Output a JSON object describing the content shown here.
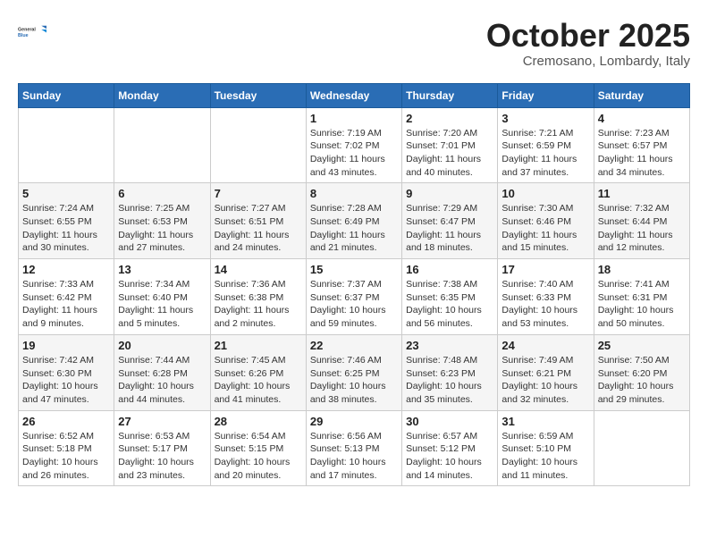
{
  "logo": {
    "general": "General",
    "blue": "Blue"
  },
  "header": {
    "month": "October 2025",
    "location": "Cremosano, Lombardy, Italy"
  },
  "weekdays": [
    "Sunday",
    "Monday",
    "Tuesday",
    "Wednesday",
    "Thursday",
    "Friday",
    "Saturday"
  ],
  "weeks": [
    [
      {
        "day": "",
        "info": ""
      },
      {
        "day": "",
        "info": ""
      },
      {
        "day": "",
        "info": ""
      },
      {
        "day": "1",
        "info": "Sunrise: 7:19 AM\nSunset: 7:02 PM\nDaylight: 11 hours\nand 43 minutes."
      },
      {
        "day": "2",
        "info": "Sunrise: 7:20 AM\nSunset: 7:01 PM\nDaylight: 11 hours\nand 40 minutes."
      },
      {
        "day": "3",
        "info": "Sunrise: 7:21 AM\nSunset: 6:59 PM\nDaylight: 11 hours\nand 37 minutes."
      },
      {
        "day": "4",
        "info": "Sunrise: 7:23 AM\nSunset: 6:57 PM\nDaylight: 11 hours\nand 34 minutes."
      }
    ],
    [
      {
        "day": "5",
        "info": "Sunrise: 7:24 AM\nSunset: 6:55 PM\nDaylight: 11 hours\nand 30 minutes."
      },
      {
        "day": "6",
        "info": "Sunrise: 7:25 AM\nSunset: 6:53 PM\nDaylight: 11 hours\nand 27 minutes."
      },
      {
        "day": "7",
        "info": "Sunrise: 7:27 AM\nSunset: 6:51 PM\nDaylight: 11 hours\nand 24 minutes."
      },
      {
        "day": "8",
        "info": "Sunrise: 7:28 AM\nSunset: 6:49 PM\nDaylight: 11 hours\nand 21 minutes."
      },
      {
        "day": "9",
        "info": "Sunrise: 7:29 AM\nSunset: 6:47 PM\nDaylight: 11 hours\nand 18 minutes."
      },
      {
        "day": "10",
        "info": "Sunrise: 7:30 AM\nSunset: 6:46 PM\nDaylight: 11 hours\nand 15 minutes."
      },
      {
        "day": "11",
        "info": "Sunrise: 7:32 AM\nSunset: 6:44 PM\nDaylight: 11 hours\nand 12 minutes."
      }
    ],
    [
      {
        "day": "12",
        "info": "Sunrise: 7:33 AM\nSunset: 6:42 PM\nDaylight: 11 hours\nand 9 minutes."
      },
      {
        "day": "13",
        "info": "Sunrise: 7:34 AM\nSunset: 6:40 PM\nDaylight: 11 hours\nand 5 minutes."
      },
      {
        "day": "14",
        "info": "Sunrise: 7:36 AM\nSunset: 6:38 PM\nDaylight: 11 hours\nand 2 minutes."
      },
      {
        "day": "15",
        "info": "Sunrise: 7:37 AM\nSunset: 6:37 PM\nDaylight: 10 hours\nand 59 minutes."
      },
      {
        "day": "16",
        "info": "Sunrise: 7:38 AM\nSunset: 6:35 PM\nDaylight: 10 hours\nand 56 minutes."
      },
      {
        "day": "17",
        "info": "Sunrise: 7:40 AM\nSunset: 6:33 PM\nDaylight: 10 hours\nand 53 minutes."
      },
      {
        "day": "18",
        "info": "Sunrise: 7:41 AM\nSunset: 6:31 PM\nDaylight: 10 hours\nand 50 minutes."
      }
    ],
    [
      {
        "day": "19",
        "info": "Sunrise: 7:42 AM\nSunset: 6:30 PM\nDaylight: 10 hours\nand 47 minutes."
      },
      {
        "day": "20",
        "info": "Sunrise: 7:44 AM\nSunset: 6:28 PM\nDaylight: 10 hours\nand 44 minutes."
      },
      {
        "day": "21",
        "info": "Sunrise: 7:45 AM\nSunset: 6:26 PM\nDaylight: 10 hours\nand 41 minutes."
      },
      {
        "day": "22",
        "info": "Sunrise: 7:46 AM\nSunset: 6:25 PM\nDaylight: 10 hours\nand 38 minutes."
      },
      {
        "day": "23",
        "info": "Sunrise: 7:48 AM\nSunset: 6:23 PM\nDaylight: 10 hours\nand 35 minutes."
      },
      {
        "day": "24",
        "info": "Sunrise: 7:49 AM\nSunset: 6:21 PM\nDaylight: 10 hours\nand 32 minutes."
      },
      {
        "day": "25",
        "info": "Sunrise: 7:50 AM\nSunset: 6:20 PM\nDaylight: 10 hours\nand 29 minutes."
      }
    ],
    [
      {
        "day": "26",
        "info": "Sunrise: 6:52 AM\nSunset: 5:18 PM\nDaylight: 10 hours\nand 26 minutes."
      },
      {
        "day": "27",
        "info": "Sunrise: 6:53 AM\nSunset: 5:17 PM\nDaylight: 10 hours\nand 23 minutes."
      },
      {
        "day": "28",
        "info": "Sunrise: 6:54 AM\nSunset: 5:15 PM\nDaylight: 10 hours\nand 20 minutes."
      },
      {
        "day": "29",
        "info": "Sunrise: 6:56 AM\nSunset: 5:13 PM\nDaylight: 10 hours\nand 17 minutes."
      },
      {
        "day": "30",
        "info": "Sunrise: 6:57 AM\nSunset: 5:12 PM\nDaylight: 10 hours\nand 14 minutes."
      },
      {
        "day": "31",
        "info": "Sunrise: 6:59 AM\nSunset: 5:10 PM\nDaylight: 10 hours\nand 11 minutes."
      },
      {
        "day": "",
        "info": ""
      }
    ]
  ]
}
